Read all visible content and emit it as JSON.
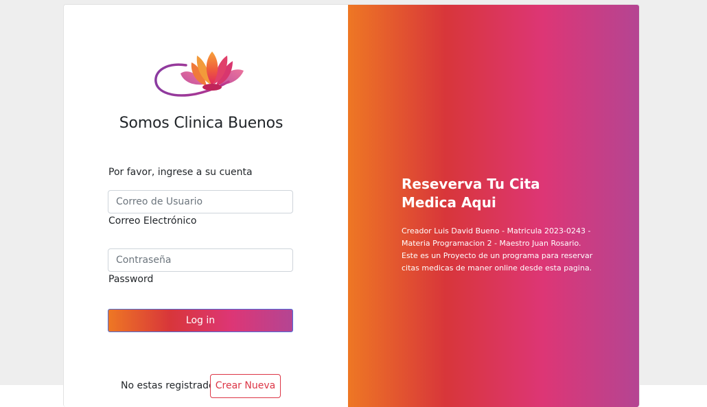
{
  "brand": {
    "title": "Somos Clinica Buenos",
    "logo_icon": "lotus-logo-icon"
  },
  "login": {
    "prompt": "Por favor, ingrese a su cuenta",
    "email_placeholder": "Correo de Usuario",
    "email_label": "Correo Electrónico",
    "password_placeholder": "Contraseña",
    "password_label": "Password",
    "submit_label": "Log in"
  },
  "register": {
    "question": "No estas registrado?",
    "button_label": "Crear Nueva"
  },
  "hero": {
    "title": "Reseverva Tu Cita Medica Aqui",
    "text": "Creador Luis David Bueno - Matricula 2023-0243 - Materia Programacion 2 - Maestro Juan Rosario. Este es un Proyecto de un programa para reservar citas medicas de maner online desde esta pagina."
  },
  "colors": {
    "gradient": [
      "#ee7724",
      "#d8363a",
      "#dd3675",
      "#b44593"
    ],
    "danger": "#dc3545",
    "page_background": "#eeeeee"
  }
}
